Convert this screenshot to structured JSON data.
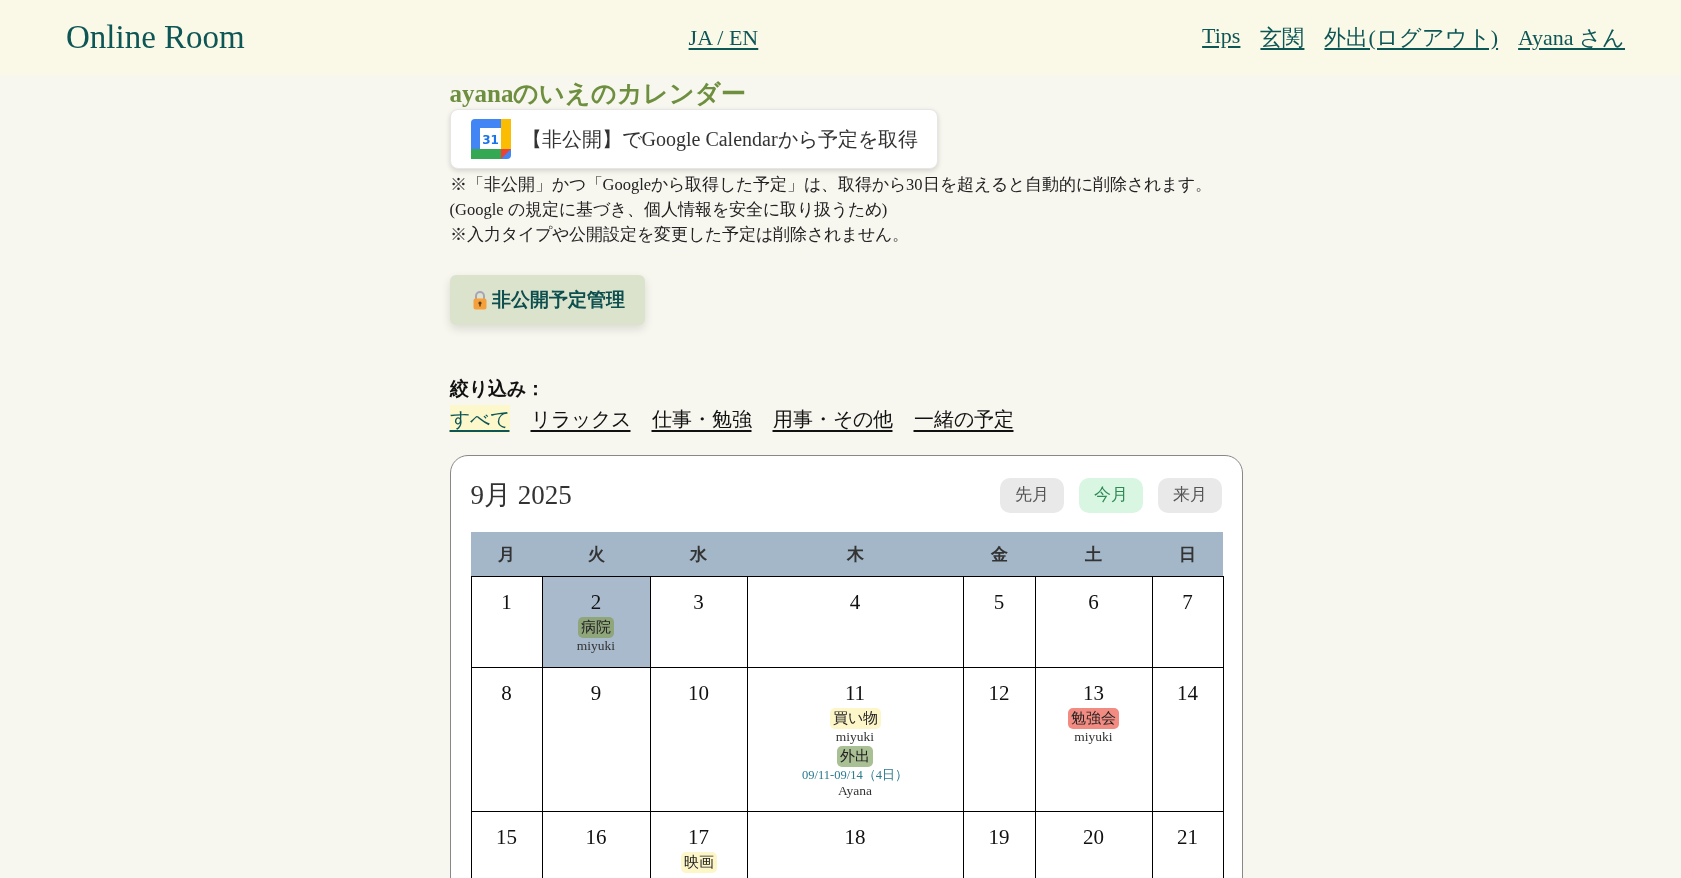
{
  "header": {
    "logo": "Online Room",
    "language_link": "JA / EN",
    "nav_links": [
      "Tips",
      "玄関",
      "外出(ログアウト)",
      "Ayana さん"
    ]
  },
  "page_title": "ayanaのいえのカレンダー",
  "google_import_button": {
    "icon_text": "31",
    "label": "【非公開】でGoogle Calendarから予定を取得"
  },
  "notes": [
    "※「非公開」かつ「Googleから取得した予定」は、取得から30日を超えると自動的に削除されます。",
    "(Google の規定に基づき、個人情報を安全に取り扱うため)",
    "※入力タイプや公開設定を変更した予定は削除されません。"
  ],
  "private_events_button": {
    "label": "非公開予定管理"
  },
  "filter": {
    "label": "絞り込み：",
    "options": [
      {
        "label": "すべて",
        "selected": true
      },
      {
        "label": "リラックス",
        "selected": false
      },
      {
        "label": "仕事・勉強",
        "selected": false
      },
      {
        "label": "用事・その他",
        "selected": false
      },
      {
        "label": "一緒の予定",
        "selected": false
      }
    ]
  },
  "calendar": {
    "month_title": "9月 2025",
    "nav_buttons": [
      {
        "label": "先月",
        "selected": false
      },
      {
        "label": "今月",
        "selected": true
      },
      {
        "label": "来月",
        "selected": false
      }
    ],
    "weekdays": [
      "月",
      "火",
      "水",
      "木",
      "金",
      "土",
      "日"
    ],
    "weeks": [
      [
        {
          "day": "1",
          "today": false
        },
        {
          "day": "2",
          "today": true,
          "events": [
            {
              "title": "病院",
              "color": "#8fa57a",
              "person": "miyuki"
            }
          ]
        },
        {
          "day": "3",
          "today": false
        },
        {
          "day": "4",
          "today": false
        },
        {
          "day": "5",
          "today": false
        },
        {
          "day": "6",
          "today": false
        },
        {
          "day": "7",
          "today": false
        }
      ],
      [
        {
          "day": "8",
          "today": false
        },
        {
          "day": "9",
          "today": false
        },
        {
          "day": "10",
          "today": false
        },
        {
          "day": "11",
          "today": false,
          "events": [
            {
              "title": "買い物",
              "color": "#fdf6c8",
              "person": "miyuki"
            },
            {
              "title": "外出",
              "color": "#a9bf94",
              "period": "09/11-09/14（4日）",
              "person": "Ayana"
            }
          ]
        },
        {
          "day": "12",
          "today": false
        },
        {
          "day": "13",
          "today": false,
          "events": [
            {
              "title": "勉強会",
              "color": "#f28b82",
              "person": "miyuki"
            }
          ]
        },
        {
          "day": "14",
          "today": false
        }
      ],
      [
        {
          "day": "15",
          "today": false
        },
        {
          "day": "16",
          "today": false
        },
        {
          "day": "17",
          "today": false,
          "events": [
            {
              "title": "映画",
              "color": "#fdf6c8"
            }
          ]
        },
        {
          "day": "18",
          "today": false
        },
        {
          "day": "19",
          "today": false
        },
        {
          "day": "20",
          "today": false
        },
        {
          "day": "21",
          "today": false
        }
      ]
    ]
  }
}
